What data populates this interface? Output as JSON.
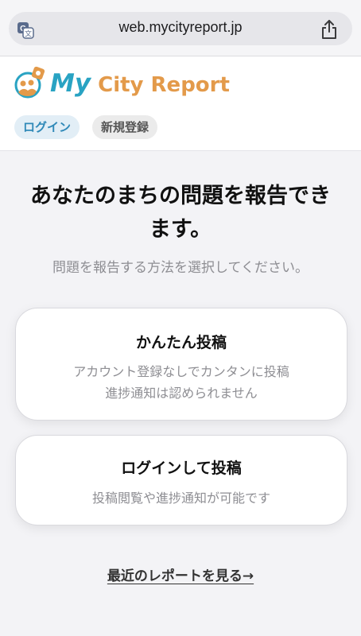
{
  "browser": {
    "url": "web.mycityreport.jp",
    "translate_icon": "translate-icon",
    "share_icon": "share-icon"
  },
  "header": {
    "logo": {
      "icon": "mycityreport-logo-icon",
      "text_my": "My",
      "text_rest": " City Report",
      "colors": {
        "my": "#29a3c3",
        "rest": "#e39a4a"
      }
    },
    "login_label": "ログイン",
    "register_label": "新規登録"
  },
  "main": {
    "headline_line1": "あなたのまちの問題を報告でき",
    "headline_line2": "ます。",
    "subtext": "問題を報告する方法を選択してください。",
    "options": [
      {
        "title": "かんたん投稿",
        "desc_line1": "アカウント登録なしでカンタンに投稿",
        "desc_line2": "進捗通知は認められません"
      },
      {
        "title": "ログインして投稿",
        "desc_line1": "投稿閲覧や進捗通知が可能です"
      }
    ],
    "recent_reports_link": "最近のレポートを見る→"
  },
  "colors": {
    "accent": "#3089b8",
    "background": "#f3f3f6"
  }
}
